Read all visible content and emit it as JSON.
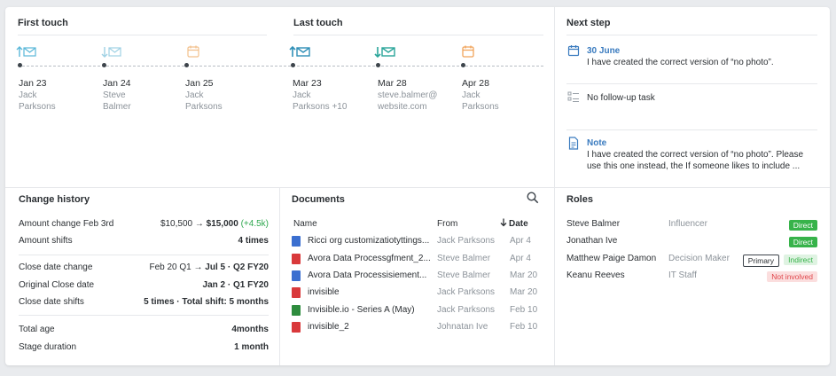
{
  "touch": {
    "first_title": "First touch",
    "last_title": "Last touch",
    "events": [
      {
        "date": "Jan 23",
        "who": [
          "Jack",
          "Parksons"
        ],
        "icon": "email-received-icon",
        "color": "#59b7d8"
      },
      {
        "date": "Jan 24",
        "who": [
          "Steve",
          "Balmer"
        ],
        "icon": "email-sent-icon",
        "color": "#9fd1e4"
      },
      {
        "date": "Jan 25",
        "who": [
          "Jack",
          "Parksons"
        ],
        "icon": "calendar-icon",
        "color": "#f2c08c"
      },
      {
        "date": "Mar 23",
        "who": [
          "Jack",
          "Parksons +10"
        ],
        "icon": "email-received-icon",
        "color": "#2f8fb7"
      },
      {
        "date": "Mar 28",
        "who": [
          "steve.balmer@",
          "website.com"
        ],
        "icon": "email-sent-icon",
        "color": "#2aa59a"
      },
      {
        "date": "Apr 28",
        "who": [
          "Jack",
          "Parksons"
        ],
        "icon": "calendar-icon",
        "color": "#f0a35a"
      }
    ]
  },
  "next_step": {
    "title": "Next step",
    "meeting_date": "30 June",
    "meeting_text": "I have created the correct version of “no photo”.",
    "task_text": "No follow-up task",
    "note_label": "Note",
    "note_line1": "I have created the correct version of “no photo”. Please",
    "note_line2": "use this one instead, the If someone likes to include ..."
  },
  "change_history": {
    "title": "Change history",
    "rows": [
      {
        "label": "Amount change Feb 3rd",
        "from": "$10,500 → ",
        "to": "$15,000",
        "delta": "(+4.5k)"
      },
      {
        "label": "Amount shifts",
        "value": "4 times"
      },
      {
        "label": "Close date change",
        "from": "Feb 20 Q1 → ",
        "to": "Jul 5 · Q2 FY20"
      },
      {
        "label": "Original Close date",
        "value": "Jan 2 · Q1 FY20"
      },
      {
        "label": "Close date shifts",
        "value": "5 times · Total shift: 5 months"
      },
      {
        "label": "Total age",
        "value": "4months"
      },
      {
        "label": "Stage duration",
        "value": "1 month"
      }
    ]
  },
  "documents": {
    "title": "Documents",
    "col_name": "Name",
    "col_from": "From",
    "col_date": "Date",
    "rows": [
      {
        "name": "Ricci org customizatiotyttings...",
        "from": "Jack Parksons",
        "date": "Apr 4",
        "type": "word",
        "color": "#3b6fd0"
      },
      {
        "name": "Avora Data Processgfment_2...",
        "from": "Steve Balmer",
        "date": "Apr 4",
        "type": "pdf",
        "color": "#d9393b"
      },
      {
        "name": "Avora Data Processisiement...",
        "from": "Steve Balmer",
        "date": "Mar 20",
        "type": "word",
        "color": "#3b6fd0"
      },
      {
        "name": "invisible",
        "from": "Jack Parksons",
        "date": "Mar 20",
        "type": "pdf",
        "color": "#d9393b"
      },
      {
        "name": "Invisible.io - Series A (May)",
        "from": "Jack Parksons",
        "date": "Feb 10",
        "type": "excel",
        "color": "#2e8c3e"
      },
      {
        "name": "invisible_2",
        "from": "Johnatan Ive",
        "date": "Feb 10",
        "type": "pdf",
        "color": "#d9393b"
      }
    ]
  },
  "roles": {
    "title": "Roles",
    "rows": [
      {
        "name": "Steve Balmer",
        "role": "Influencer",
        "badges": [
          {
            "text": "Direct",
            "kind": "direct"
          }
        ]
      },
      {
        "name": "Jonathan Ive",
        "role": "",
        "badges": [
          {
            "text": "Direct",
            "kind": "direct"
          }
        ]
      },
      {
        "name": "Matthew Paige Damon",
        "role": "Decision Maker",
        "badges": [
          {
            "text": "Primary",
            "kind": "primary"
          },
          {
            "text": "Indirect",
            "kind": "indirect"
          }
        ]
      },
      {
        "name": "Keanu Reeves",
        "role": "IT Staff",
        "badges": [
          {
            "text": "Not involved",
            "kind": "notinv"
          }
        ]
      }
    ]
  }
}
